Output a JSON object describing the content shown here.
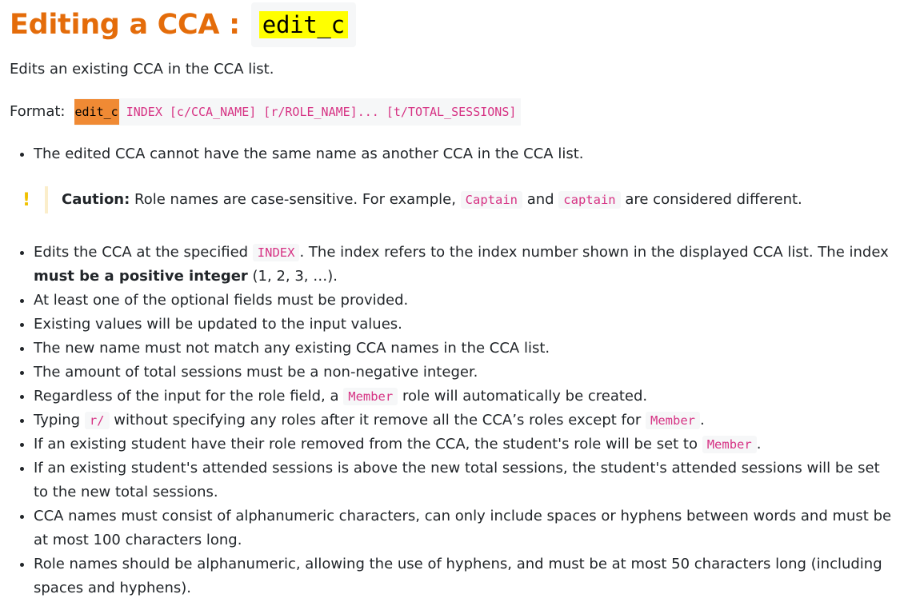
{
  "title": {
    "text": "Editing a CCA :",
    "command": "edit_c"
  },
  "description": "Edits an existing CCA in the CCA list.",
  "format": {
    "label": "Format:",
    "command": "edit_c",
    "args": " INDEX [c/CCA_NAME] [r/ROLE_NAME]... [t/TOTAL_SESSIONS]"
  },
  "first_list": [
    "The edited CCA cannot have the same name as another CCA in the CCA list."
  ],
  "caution": {
    "icon": "!",
    "label": "Caution:",
    "text_1": " Role names are case-sensitive. For example, ",
    "code_1": "Captain",
    "text_2": " and ",
    "code_2": "captain",
    "text_3": " are considered different."
  },
  "bullets": {
    "b1_t1": "Edits the CCA at the specified ",
    "b1_code": "INDEX",
    "b1_t2": ". The index refers to the index number shown in the displayed CCA list. The index ",
    "b1_bold": "must be a positive integer",
    "b1_t3": " (1, 2, 3, …).",
    "b2": "At least one of the optional fields must be provided.",
    "b3": "Existing values will be updated to the input values.",
    "b4": "The new name must not match any existing CCA names in the CCA list.",
    "b5": "The amount of total sessions must be a non-negative integer.",
    "b6_t1": "Regardless of the input for the role field, a ",
    "b6_code": "Member",
    "b6_t2": " role will automatically be created.",
    "b7_t1": "Typing ",
    "b7_code1": "r/",
    "b7_t2": " without specifying any roles after it remove all the CCA’s roles except for ",
    "b7_code2": "Member",
    "b7_t3": ".",
    "b8_t1": "If an existing student have their role removed from the CCA, the student's role will be set to ",
    "b8_code": "Member",
    "b8_t2": ".",
    "b9": "If an existing student's attended sessions is above the new total sessions, the student's attended sessions will be set to the new total sessions.",
    "b10": "CCA names must consist of alphanumeric characters, can only include spaces or hyphens between words and must be at most 100 characters long.",
    "b11": "Role names should be alphanumeric, allowing the use of hyphens, and must be at most 50 characters long (including spaces and hyphens)."
  },
  "colors": {
    "heading": "#e46c0a",
    "code_text": "#d63384",
    "code_bg": "#f6f7f8",
    "highlight_yellow": "#ffff00",
    "highlight_orange": "#f08a34",
    "caution_icon": "#f0c100"
  }
}
